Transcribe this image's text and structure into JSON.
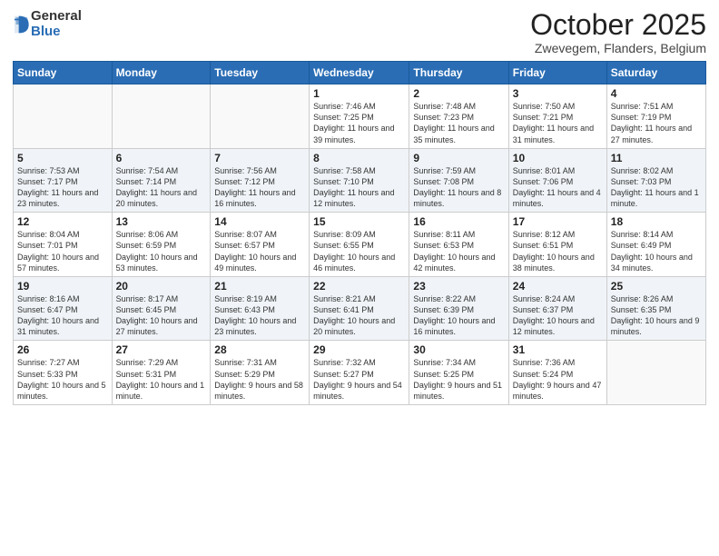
{
  "logo": {
    "general": "General",
    "blue": "Blue"
  },
  "header": {
    "title": "October 2025",
    "subtitle": "Zwevegem, Flanders, Belgium"
  },
  "days": [
    "Sunday",
    "Monday",
    "Tuesday",
    "Wednesday",
    "Thursday",
    "Friday",
    "Saturday"
  ],
  "weeks": [
    [
      {
        "num": "",
        "info": ""
      },
      {
        "num": "",
        "info": ""
      },
      {
        "num": "",
        "info": ""
      },
      {
        "num": "1",
        "info": "Sunrise: 7:46 AM\nSunset: 7:25 PM\nDaylight: 11 hours\nand 39 minutes."
      },
      {
        "num": "2",
        "info": "Sunrise: 7:48 AM\nSunset: 7:23 PM\nDaylight: 11 hours\nand 35 minutes."
      },
      {
        "num": "3",
        "info": "Sunrise: 7:50 AM\nSunset: 7:21 PM\nDaylight: 11 hours\nand 31 minutes."
      },
      {
        "num": "4",
        "info": "Sunrise: 7:51 AM\nSunset: 7:19 PM\nDaylight: 11 hours\nand 27 minutes."
      }
    ],
    [
      {
        "num": "5",
        "info": "Sunrise: 7:53 AM\nSunset: 7:17 PM\nDaylight: 11 hours\nand 23 minutes."
      },
      {
        "num": "6",
        "info": "Sunrise: 7:54 AM\nSunset: 7:14 PM\nDaylight: 11 hours\nand 20 minutes."
      },
      {
        "num": "7",
        "info": "Sunrise: 7:56 AM\nSunset: 7:12 PM\nDaylight: 11 hours\nand 16 minutes."
      },
      {
        "num": "8",
        "info": "Sunrise: 7:58 AM\nSunset: 7:10 PM\nDaylight: 11 hours\nand 12 minutes."
      },
      {
        "num": "9",
        "info": "Sunrise: 7:59 AM\nSunset: 7:08 PM\nDaylight: 11 hours\nand 8 minutes."
      },
      {
        "num": "10",
        "info": "Sunrise: 8:01 AM\nSunset: 7:06 PM\nDaylight: 11 hours\nand 4 minutes."
      },
      {
        "num": "11",
        "info": "Sunrise: 8:02 AM\nSunset: 7:03 PM\nDaylight: 11 hours\nand 1 minute."
      }
    ],
    [
      {
        "num": "12",
        "info": "Sunrise: 8:04 AM\nSunset: 7:01 PM\nDaylight: 10 hours\nand 57 minutes."
      },
      {
        "num": "13",
        "info": "Sunrise: 8:06 AM\nSunset: 6:59 PM\nDaylight: 10 hours\nand 53 minutes."
      },
      {
        "num": "14",
        "info": "Sunrise: 8:07 AM\nSunset: 6:57 PM\nDaylight: 10 hours\nand 49 minutes."
      },
      {
        "num": "15",
        "info": "Sunrise: 8:09 AM\nSunset: 6:55 PM\nDaylight: 10 hours\nand 46 minutes."
      },
      {
        "num": "16",
        "info": "Sunrise: 8:11 AM\nSunset: 6:53 PM\nDaylight: 10 hours\nand 42 minutes."
      },
      {
        "num": "17",
        "info": "Sunrise: 8:12 AM\nSunset: 6:51 PM\nDaylight: 10 hours\nand 38 minutes."
      },
      {
        "num": "18",
        "info": "Sunrise: 8:14 AM\nSunset: 6:49 PM\nDaylight: 10 hours\nand 34 minutes."
      }
    ],
    [
      {
        "num": "19",
        "info": "Sunrise: 8:16 AM\nSunset: 6:47 PM\nDaylight: 10 hours\nand 31 minutes."
      },
      {
        "num": "20",
        "info": "Sunrise: 8:17 AM\nSunset: 6:45 PM\nDaylight: 10 hours\nand 27 minutes."
      },
      {
        "num": "21",
        "info": "Sunrise: 8:19 AM\nSunset: 6:43 PM\nDaylight: 10 hours\nand 23 minutes."
      },
      {
        "num": "22",
        "info": "Sunrise: 8:21 AM\nSunset: 6:41 PM\nDaylight: 10 hours\nand 20 minutes."
      },
      {
        "num": "23",
        "info": "Sunrise: 8:22 AM\nSunset: 6:39 PM\nDaylight: 10 hours\nand 16 minutes."
      },
      {
        "num": "24",
        "info": "Sunrise: 8:24 AM\nSunset: 6:37 PM\nDaylight: 10 hours\nand 12 minutes."
      },
      {
        "num": "25",
        "info": "Sunrise: 8:26 AM\nSunset: 6:35 PM\nDaylight: 10 hours\nand 9 minutes."
      }
    ],
    [
      {
        "num": "26",
        "info": "Sunrise: 7:27 AM\nSunset: 5:33 PM\nDaylight: 10 hours\nand 5 minutes."
      },
      {
        "num": "27",
        "info": "Sunrise: 7:29 AM\nSunset: 5:31 PM\nDaylight: 10 hours\nand 1 minute."
      },
      {
        "num": "28",
        "info": "Sunrise: 7:31 AM\nSunset: 5:29 PM\nDaylight: 9 hours\nand 58 minutes."
      },
      {
        "num": "29",
        "info": "Sunrise: 7:32 AM\nSunset: 5:27 PM\nDaylight: 9 hours\nand 54 minutes."
      },
      {
        "num": "30",
        "info": "Sunrise: 7:34 AM\nSunset: 5:25 PM\nDaylight: 9 hours\nand 51 minutes."
      },
      {
        "num": "31",
        "info": "Sunrise: 7:36 AM\nSunset: 5:24 PM\nDaylight: 9 hours\nand 47 minutes."
      },
      {
        "num": "",
        "info": ""
      }
    ]
  ]
}
